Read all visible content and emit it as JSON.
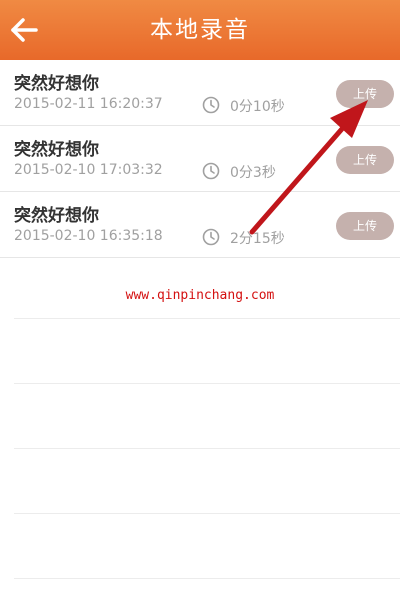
{
  "header": {
    "title": "本地录音",
    "back_icon": "arrow-left-icon"
  },
  "recordings": [
    {
      "title": "突然好想你",
      "date": "2015-02-11 16:20:37",
      "duration": "0分10秒",
      "upload_label": "上传"
    },
    {
      "title": "突然好想你",
      "date": "2015-02-10 17:03:32",
      "duration": "0分3秒",
      "upload_label": "上传"
    },
    {
      "title": "突然好想你",
      "date": "2015-02-10 16:35:18",
      "duration": "2分15秒",
      "upload_label": "上传"
    }
  ],
  "watermark": "www.qinpinchang.com",
  "colors": {
    "header": "#e8692a",
    "upload_button": "#c5b1ad",
    "annotation_arrow": "#c0161b"
  }
}
